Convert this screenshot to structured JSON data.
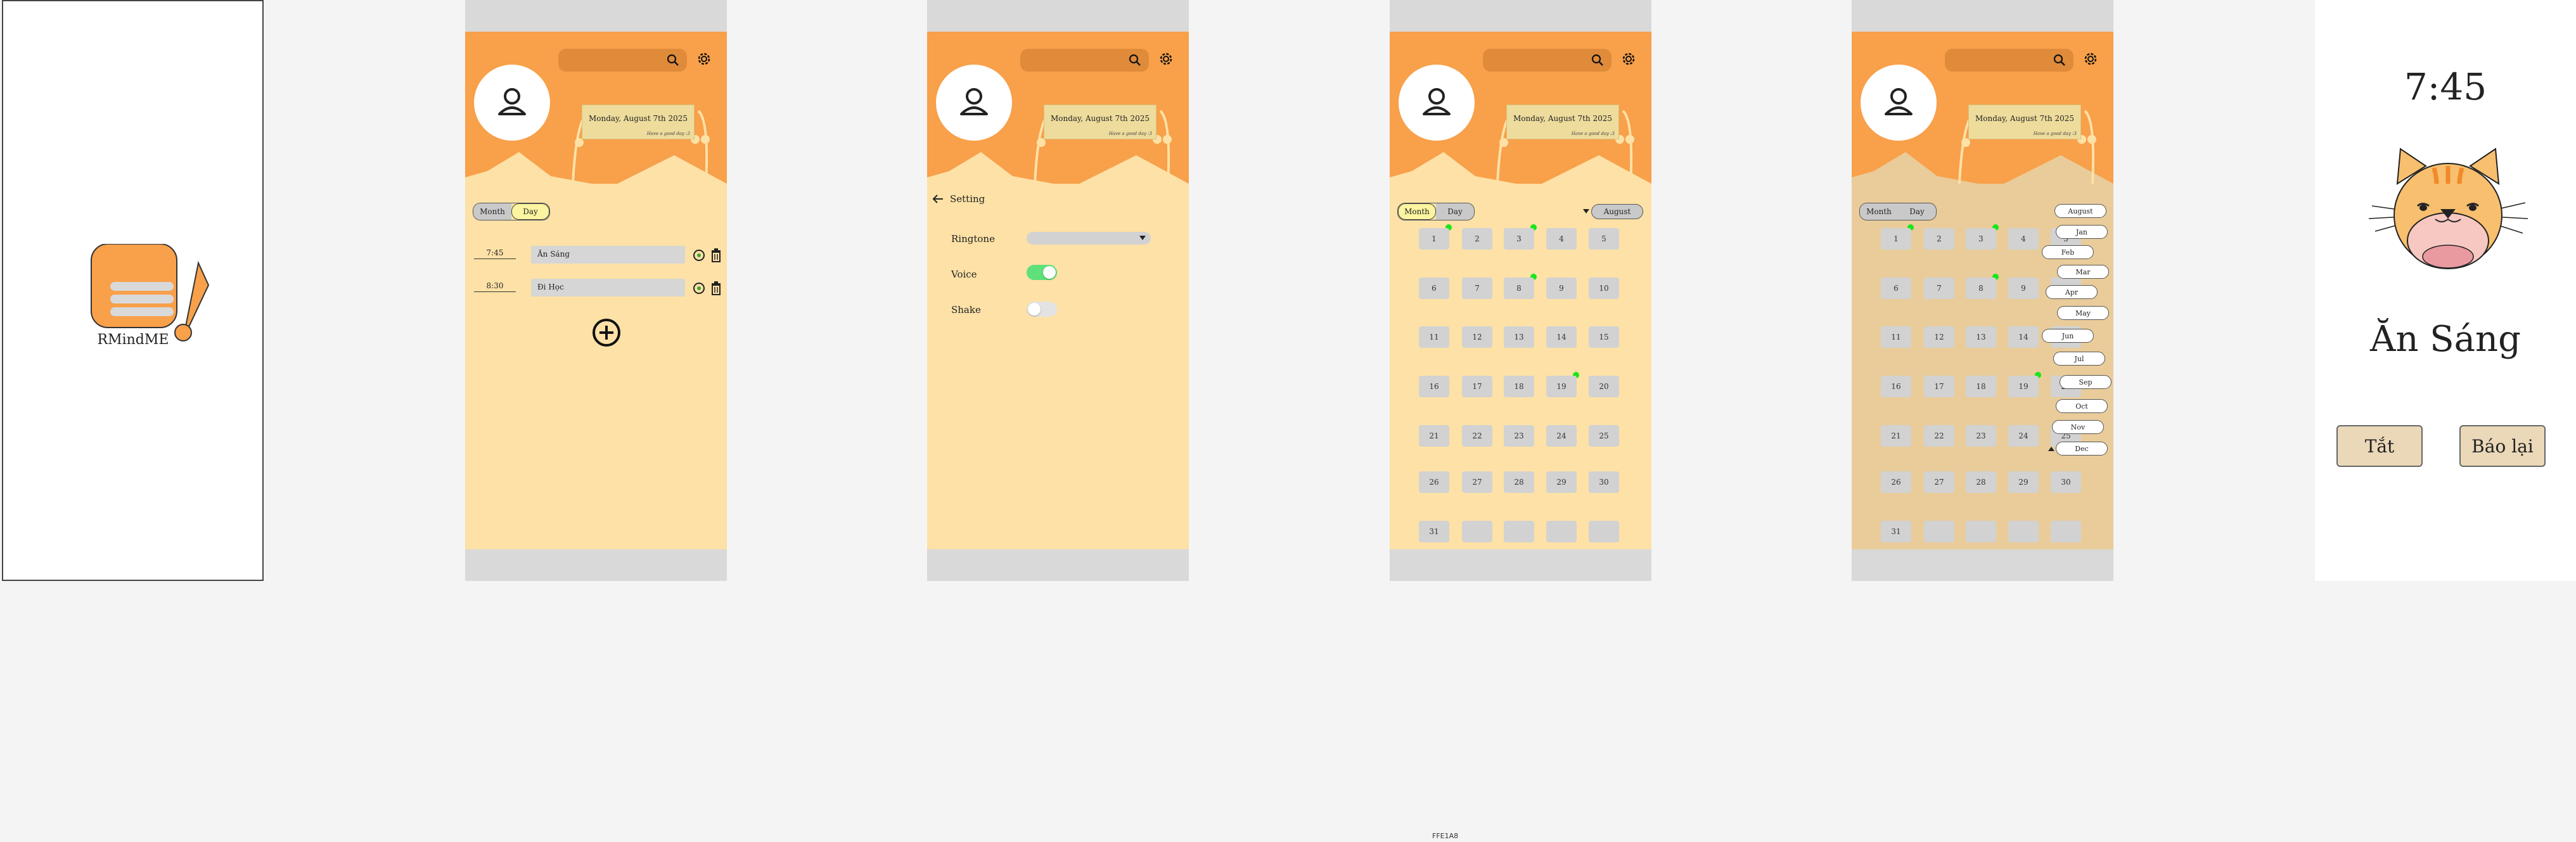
{
  "splash": {
    "app_name": "RMindME"
  },
  "header": {
    "date": "Monday, August 7th 2025",
    "greeting": "Have a good day :3"
  },
  "view_toggle": {
    "month": "Month",
    "day": "Day"
  },
  "reminders": [
    {
      "time": "7:45",
      "title": "Ăn Sáng"
    },
    {
      "time": "8:30",
      "title": "Đi Học"
    }
  ],
  "settings": {
    "back_title": "Setting",
    "ringtone_label": "Ringtone",
    "ringtone_value": "",
    "voice_label": "Voice",
    "voice_on": true,
    "shake_label": "Shake",
    "shake_on": false
  },
  "calendar": {
    "selected_month": "August",
    "days": [
      "1",
      "2",
      "3",
      "4",
      "5",
      "6",
      "7",
      "8",
      "9",
      "10",
      "11",
      "12",
      "13",
      "14",
      "15",
      "16",
      "17",
      "18",
      "19",
      "20",
      "21",
      "22",
      "23",
      "24",
      "25",
      "26",
      "27",
      "28",
      "29",
      "30",
      "31"
    ],
    "days_with_reminders": [
      "1",
      "3",
      "8",
      "19"
    ]
  },
  "month_options": [
    "August",
    "Jan",
    "Feb",
    "Mar",
    "Apr",
    "May",
    "Jun",
    "Jul",
    "Sep",
    "Oct",
    "Nov",
    "Dec"
  ],
  "alarm": {
    "time": "7:45",
    "title": "Ăn Sáng",
    "off_label": "Tắt",
    "snooze_label": "Báo lại"
  },
  "canvas_caption": "FFE1A8",
  "colors": {
    "header_orange": "#f8a04a",
    "body_cream": "#fde1a6",
    "toggle_green": "#5ee07a",
    "reminder_dot": "#19e619"
  }
}
